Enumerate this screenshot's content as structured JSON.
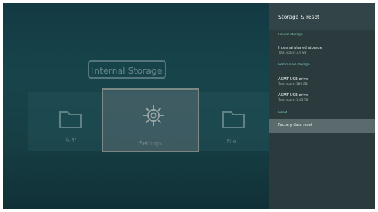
{
  "launcher": {
    "storage_title": "Internal Storage",
    "tiles": {
      "app_label": "APP",
      "settings_label": "Settings",
      "file_label": "File"
    },
    "icons": {
      "app": "folder-icon",
      "settings": "gear-icon",
      "file": "folder-icon"
    }
  },
  "panel": {
    "title": "Storage & reset",
    "sections": {
      "device_storage": "Device storage",
      "removable_storage": "Removable storage",
      "reset": "Reset"
    },
    "items": {
      "internal_title": "Internal shared storage",
      "internal_sub": "Total space: 3.9 GB",
      "usb1_title": "ASMT USB drive",
      "usb1_sub": "Total space: 386 GB",
      "usb2_title": "ASMT USB drive",
      "usb2_sub": "Total space: 3.43 TB",
      "factory_reset": "Factory data reset"
    }
  },
  "colors": {
    "background_top": "#133a44",
    "background_bottom": "#103037",
    "panel": "#2b3a3d",
    "panel_header": "#324447",
    "selection": "#5b6a6d",
    "section_accent": "#7fcfb8"
  }
}
